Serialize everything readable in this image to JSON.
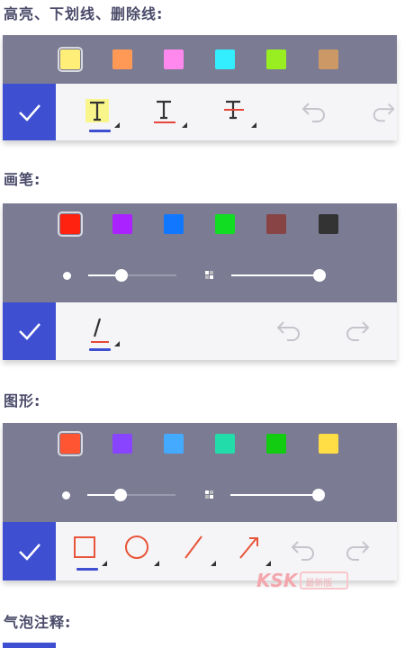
{
  "sections": {
    "text_markup": {
      "title": "高亮、下划线、删除线:"
    },
    "pen": {
      "title": "画笔:"
    },
    "shapes": {
      "title": "图形:"
    },
    "bubble": {
      "title": "气泡注释:"
    }
  },
  "palettes": {
    "text_markup": [
      "#ffee77",
      "#ff9955",
      "#ff88ee",
      "#33eeff",
      "#99ee22",
      "#cc9966"
    ],
    "pen": [
      "#ff2211",
      "#aa22ff",
      "#1177ff",
      "#11dd22",
      "#884444",
      "#333333"
    ],
    "shapes": [
      "#ff5533",
      "#8844ff",
      "#44aaff",
      "#22ddaa",
      "#11cc11",
      "#ffdd44"
    ]
  },
  "sliders": {
    "pen": {
      "thickness": 0.38,
      "opacity": 1.0
    },
    "shapes": {
      "thickness": 0.38,
      "opacity": 1.0
    }
  },
  "icons": {
    "check": "check-icon",
    "highlight": "highlight-text-icon",
    "underline": "underline-text-icon",
    "strikethrough": "strikethrough-text-icon",
    "undo": "undo-icon",
    "redo": "redo-icon",
    "pen": "pen-icon",
    "rectangle": "rectangle-icon",
    "ellipse": "ellipse-icon",
    "line": "line-icon",
    "arrow": "arrow-icon"
  },
  "colors": {
    "accent": "#3f4fd1",
    "panel_bg": "#7b7b93",
    "toolbar_bg": "#f5f5f7",
    "shape_stroke": "#e8553a"
  },
  "watermark": {
    "logo": "KSK",
    "text": "最新版"
  }
}
